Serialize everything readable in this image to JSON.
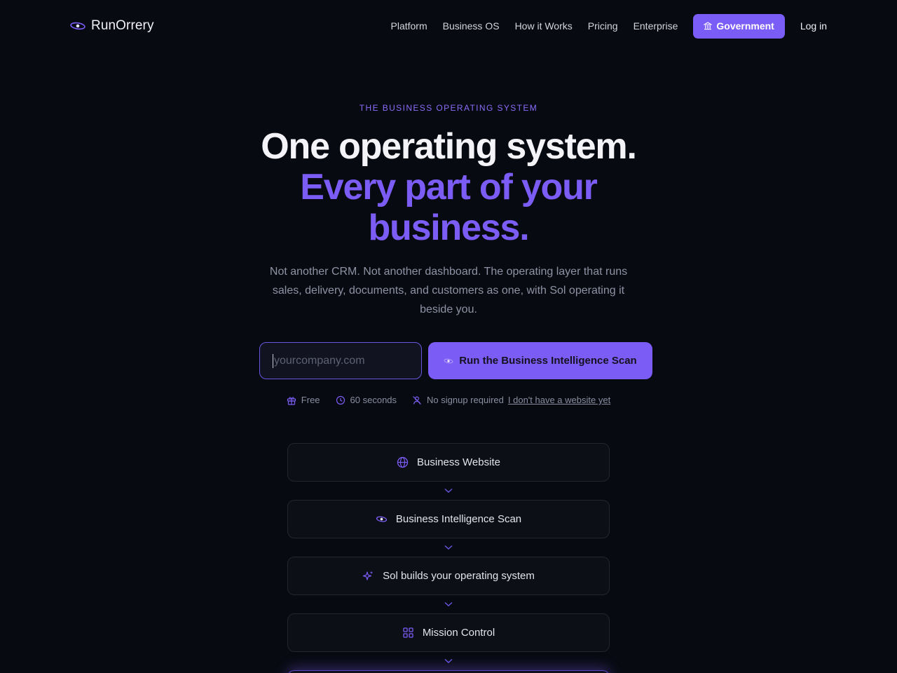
{
  "nav": {
    "brand": "RunOrrery",
    "links": [
      "Platform",
      "Business OS",
      "How it Works",
      "Pricing",
      "Enterprise"
    ],
    "government_label": "Government",
    "login_label": "Log in"
  },
  "hero": {
    "eyebrow": "THE BUSINESS OPERATING SYSTEM",
    "headline_line1": "One operating system.",
    "headline_line2": "Every part of your business.",
    "subtitle": "Not another CRM. Not another dashboard. The operating layer that runs sales, delivery, documents, and customers as one, with Sol operating it beside you."
  },
  "scan_form": {
    "input_value": "",
    "input_placeholder": "yourcompany.com",
    "button_label": "Run the Business Intelligence Scan"
  },
  "perks": {
    "items": [
      "Free",
      "60 seconds",
      "No signup required"
    ],
    "no_website_link": "I don't have a website yet"
  },
  "flow": {
    "steps": [
      {
        "label": "Business Website",
        "icon": "globe-icon"
      },
      {
        "label": "Business Intelligence Scan",
        "icon": "eye-icon"
      },
      {
        "label": "Sol builds your operating system",
        "icon": "sparkles-icon"
      },
      {
        "label": "Mission Control",
        "icon": "grid-icon"
      }
    ]
  },
  "colors": {
    "background": "#080a12",
    "accent": "#7b5cf5",
    "muted_text": "#8f92a3"
  }
}
